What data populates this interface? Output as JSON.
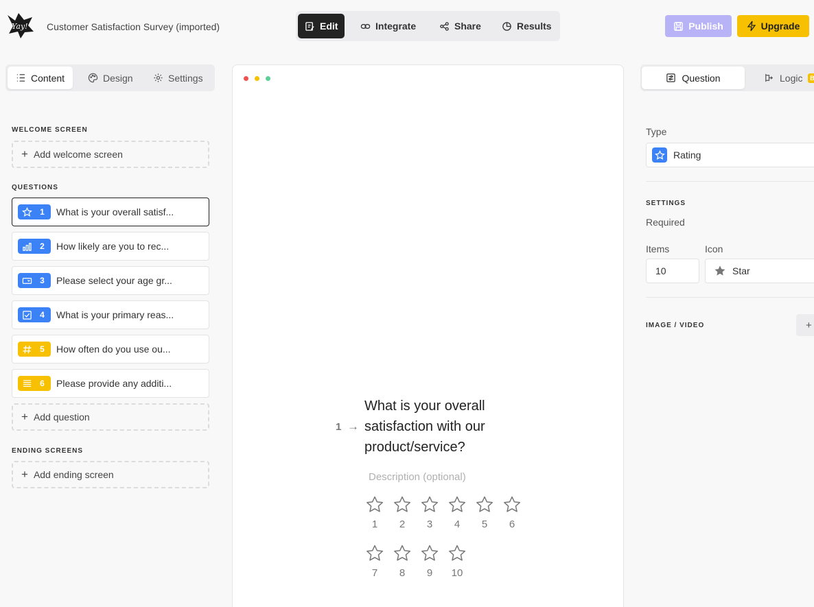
{
  "app": {
    "logo_text": "Yay!"
  },
  "header": {
    "survey_title": "Customer Satisfaction Survey (imported)",
    "mode_tabs": [
      {
        "label": "Edit",
        "icon": "edit-icon",
        "active": true
      },
      {
        "label": "Integrate",
        "icon": "link-icon",
        "active": false
      },
      {
        "label": "Share",
        "icon": "share-icon",
        "active": false
      },
      {
        "label": "Results",
        "icon": "chart-pie-icon",
        "active": false
      }
    ],
    "publish_label": "Publish",
    "upgrade_label": "Upgrade",
    "colors": {
      "publish": "#b7b3f6",
      "upgrade": "#f7c000",
      "active_tab": "#232323"
    }
  },
  "left_panel": {
    "tabs": [
      {
        "label": "Content",
        "icon": "list-icon",
        "active": true
      },
      {
        "label": "Design",
        "icon": "palette-icon",
        "active": false
      },
      {
        "label": "Settings",
        "icon": "gear-icon",
        "active": false
      }
    ],
    "welcome_title": "WELCOME SCREEN",
    "add_welcome": "Add welcome screen",
    "questions_title": "QUESTIONS",
    "questions": [
      {
        "num": "1",
        "text": "What is your overall satisf...",
        "icon": "star-icon",
        "color": "#3b82f6",
        "active": true
      },
      {
        "num": "2",
        "text": "How likely are you to rec...",
        "icon": "bar-chart-icon",
        "color": "#3b82f6",
        "active": false
      },
      {
        "num": "3",
        "text": "Please select your age gr...",
        "icon": "dropdown-icon",
        "color": "#3b82f6",
        "active": false
      },
      {
        "num": "4",
        "text": "What is your primary reas...",
        "icon": "checkbox-icon",
        "color": "#3b82f6",
        "active": false
      },
      {
        "num": "5",
        "text": "How often do you use ou...",
        "icon": "hash-icon",
        "color": "#f7c000",
        "active": false
      },
      {
        "num": "6",
        "text": "Please provide any additi...",
        "icon": "text-lines-icon",
        "color": "#f7c000",
        "active": false
      }
    ],
    "add_question": "Add question",
    "ending_title": "ENDING SCREENS",
    "add_ending": "Add ending screen"
  },
  "preview": {
    "window_dots": [
      "#ef5350",
      "#f7c000",
      "#5fcf9a"
    ],
    "question_number": "1",
    "arrow": "→",
    "question_title": "What is your overall satisfaction with our product/service?",
    "description_placeholder": "Description (optional)",
    "rating_labels": [
      "1",
      "2",
      "3",
      "4",
      "5",
      "6",
      "7",
      "8",
      "9",
      "10"
    ]
  },
  "right_panel": {
    "tabs": [
      {
        "label": "Question",
        "icon": "question-settings-icon",
        "active": true
      },
      {
        "label": "Logic",
        "icon": "logic-icon",
        "active": false,
        "badge": "B"
      }
    ],
    "type_label": "Type",
    "type_value": "Rating",
    "settings_title": "SETTINGS",
    "required_label": "Required",
    "items_label": "Items",
    "items_value": "10",
    "icon_label": "Icon",
    "icon_value": "Star",
    "media_title": "IMAGE / VIDEO",
    "media_add": "+"
  }
}
